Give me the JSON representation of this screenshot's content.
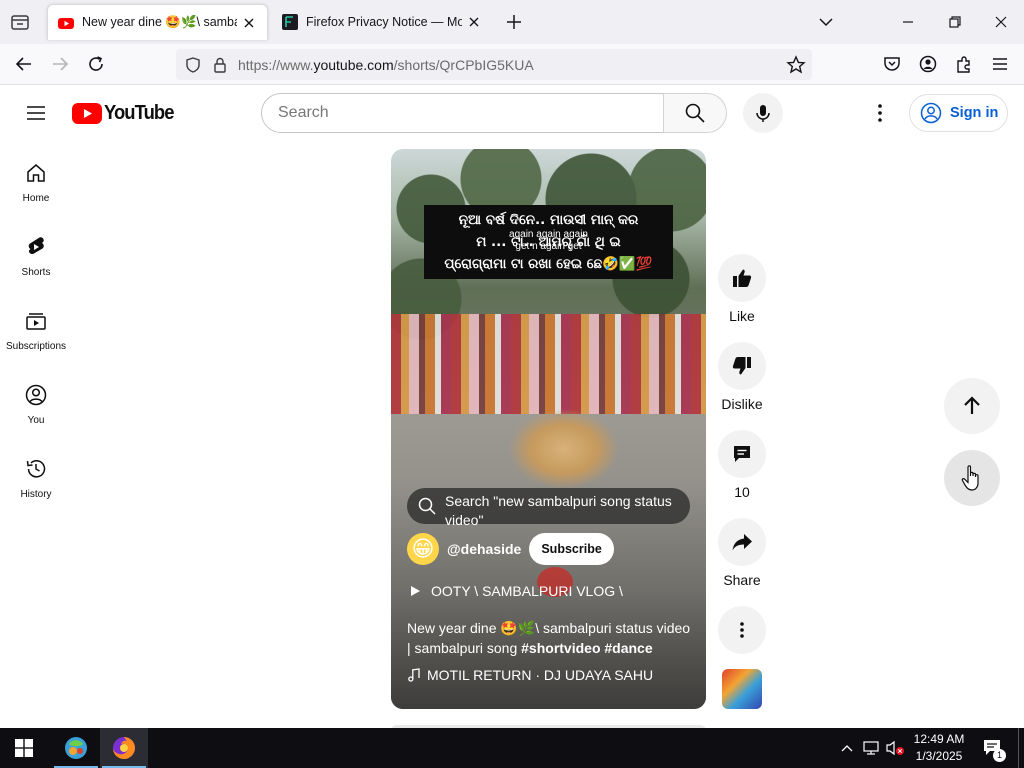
{
  "browser": {
    "tabs": [
      {
        "title": "New year dine 🤩🌿\\ sambalpuri",
        "active": true
      },
      {
        "title": "Firefox Privacy Notice — Mozilla",
        "active": false
      }
    ],
    "url": {
      "prefix": "https://www.",
      "domain": "youtube.com",
      "path": "/shorts/QrCPbIG5KUA"
    }
  },
  "youtube": {
    "logo_text": "YouTube",
    "search_placeholder": "Search",
    "sign_in_label": "Sign in",
    "guide": [
      {
        "label": "Home",
        "icon": "home-icon"
      },
      {
        "label": "Shorts",
        "icon": "shorts-icon"
      },
      {
        "label": "Subscriptions",
        "icon": "subscriptions-icon"
      },
      {
        "label": "You",
        "icon": "you-icon"
      },
      {
        "label": "History",
        "icon": "history-icon"
      }
    ]
  },
  "short": {
    "caption_lines": [
      "ନୂଆ ବର୍ଷ ଦିନେ.. ମାଉସୀ ମାନ୍ କର",
      "ମ ... ଟା.. ଆମର୍ ଗାଁ ଥି ଇ",
      "ପ୍ରୋଗ୍ରାମା ଟା ରଖା ହେଇ ଛେ🤣✅💯"
    ],
    "caption_overlay": [
      "again again again",
      "get n again get"
    ],
    "search_suggestion": "Search \"new sambalpuri song status video\"",
    "channel_handle": "@dehaside",
    "subscribe_label": "Subscribe",
    "playlist": "OOTY \\ SAMBALPURI VLOG \\",
    "title_text": "New year dine 🤩🌿\\ sambalpuri status video | sambalpuri song ",
    "hashtags": "#shortvideo #dance",
    "music": "MOTIL RETURN · DJ UDAYA SAHU"
  },
  "actions": {
    "like": "Like",
    "dislike": "Dislike",
    "comments": "10",
    "share": "Share"
  },
  "taskbar": {
    "time": "12:49 AM",
    "date": "1/3/2025",
    "notification_count": "1"
  },
  "colors": {
    "youtube_red": "#ff0000",
    "signin_blue": "#065fd4",
    "taskbar_bg": "#0d0d12"
  }
}
